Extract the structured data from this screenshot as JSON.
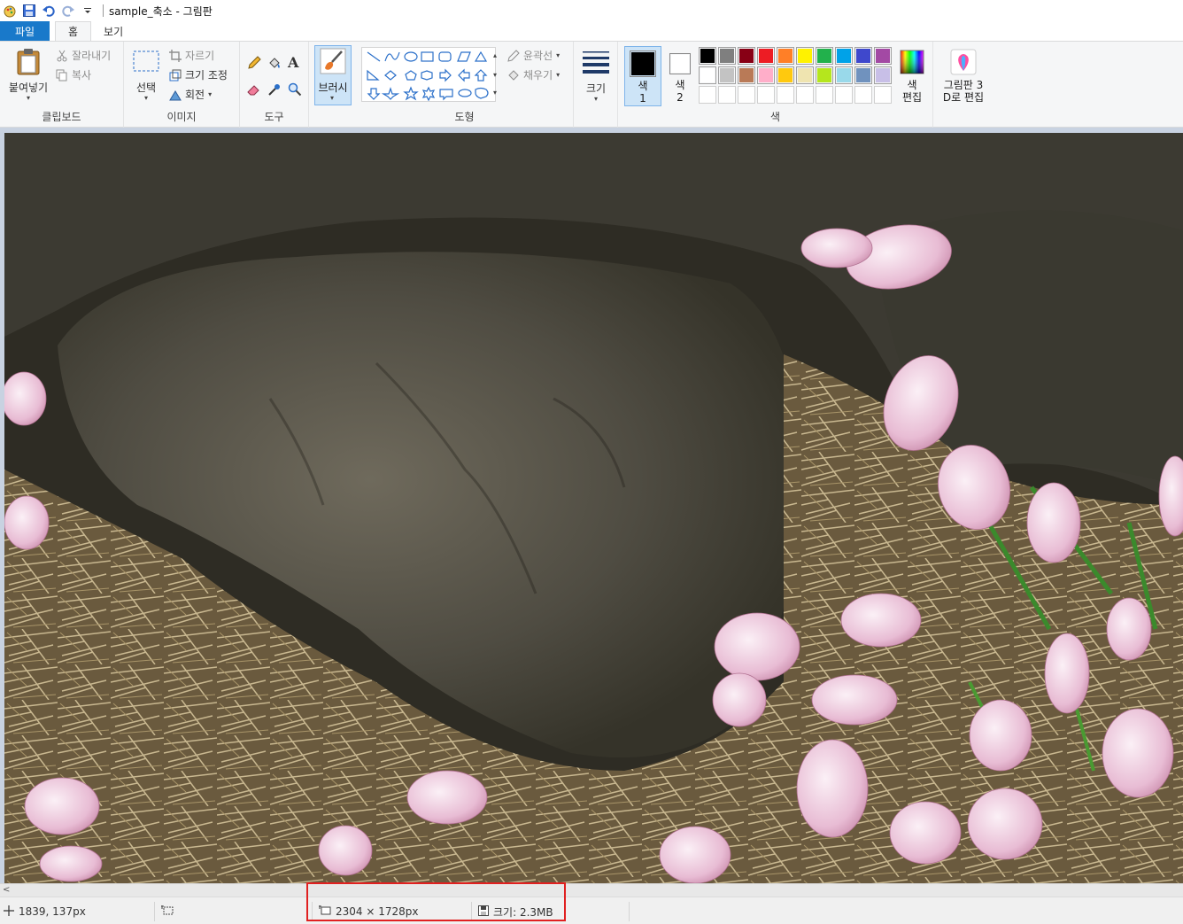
{
  "window": {
    "title": "sample_축소 - 그림판"
  },
  "tabs": [
    {
      "label": "파일"
    },
    {
      "label": "홈"
    },
    {
      "label": "보기"
    }
  ],
  "ribbon": {
    "clipboard": {
      "paste_label": "붙여넣기",
      "cut_label": "잘라내기",
      "copy_label": "복사",
      "group_label": "클립보드"
    },
    "image": {
      "select_label": "선택",
      "crop_label": "자르기",
      "resize_label": "크기 조정",
      "rotate_label": "회전",
      "group_label": "이미지"
    },
    "tools": {
      "group_label": "도구"
    },
    "brush": {
      "label": "브러시"
    },
    "shapes": {
      "outline_label": "윤곽선",
      "fill_label": "채우기",
      "group_label": "도형"
    },
    "size": {
      "label": "크기"
    },
    "colors": {
      "color1_label_a": "색",
      "color1_label_b": "1",
      "color2_label_a": "색",
      "color2_label_b": "2",
      "edit_label_a": "색",
      "edit_label_b": "편집",
      "group_label": "색",
      "color1_value": "#000000",
      "color2_value": "#ffffff",
      "palette_row1": [
        "#000000",
        "#7f7f7f",
        "#880015",
        "#ed1c24",
        "#ff7f27",
        "#fff200",
        "#22b14c",
        "#00a2e8",
        "#3f48cc",
        "#a349a4"
      ],
      "palette_row2": [
        "#ffffff",
        "#c3c3c3",
        "#b97a57",
        "#ffaec9",
        "#ffc90e",
        "#efe4b0",
        "#b5e61d",
        "#99d9ea",
        "#7092be",
        "#c8bfe7"
      ]
    },
    "paint3d": {
      "label_a": "그림판 3",
      "label_b": "D로 편집"
    }
  },
  "status": {
    "cursor_pos": "1839, 137px",
    "image_dims": "2304 × 1728px",
    "file_size": "크기: 2.3MB"
  }
}
